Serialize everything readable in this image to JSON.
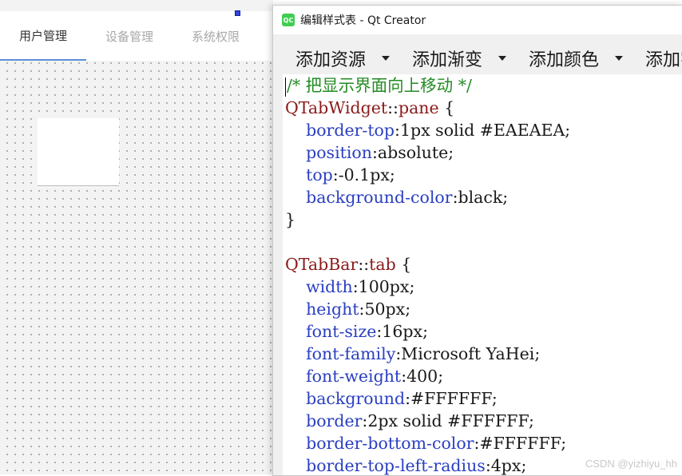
{
  "designer": {
    "tabs": [
      {
        "label": "用户管理",
        "active": true
      },
      {
        "label": "设备管理",
        "active": false
      },
      {
        "label": "系统权限",
        "active": false
      }
    ]
  },
  "dialog": {
    "title": "编辑样式表 - Qt Creator",
    "icon": "qt-logo-icon",
    "logo_text": "QC",
    "toolbar": [
      "添加资源",
      "添加渐变",
      "添加颜色",
      "添加字"
    ],
    "code": [
      [
        {
          "t": "/* 把显示界面向上移动 */",
          "c": "c-comment"
        }
      ],
      [
        {
          "t": "QTabWidget",
          "c": "c-sel"
        },
        {
          "t": "::",
          "c": "c-val"
        },
        {
          "t": "pane",
          "c": "c-sel"
        },
        {
          "t": " {",
          "c": "c-val"
        }
      ],
      [
        {
          "t": "    ",
          "c": "c-val"
        },
        {
          "t": "border-top",
          "c": "c-prop"
        },
        {
          "t": ":1px solid #EAEAEA;",
          "c": "c-val"
        }
      ],
      [
        {
          "t": "    ",
          "c": "c-val"
        },
        {
          "t": "position",
          "c": "c-prop"
        },
        {
          "t": ":absolute;",
          "c": "c-val"
        }
      ],
      [
        {
          "t": "    ",
          "c": "c-val"
        },
        {
          "t": "top",
          "c": "c-prop"
        },
        {
          "t": ":-0.1px;",
          "c": "c-val"
        }
      ],
      [
        {
          "t": "    ",
          "c": "c-val"
        },
        {
          "t": "background-color",
          "c": "c-prop"
        },
        {
          "t": ":black;",
          "c": "c-val"
        }
      ],
      [
        {
          "t": "}",
          "c": "c-val"
        }
      ],
      [],
      [
        {
          "t": "QTabBar",
          "c": "c-sel"
        },
        {
          "t": "::",
          "c": "c-val"
        },
        {
          "t": "tab",
          "c": "c-sel"
        },
        {
          "t": " {",
          "c": "c-val"
        }
      ],
      [
        {
          "t": "    ",
          "c": "c-val"
        },
        {
          "t": "width",
          "c": "c-prop"
        },
        {
          "t": ":100px;",
          "c": "c-val"
        }
      ],
      [
        {
          "t": "    ",
          "c": "c-val"
        },
        {
          "t": "height",
          "c": "c-prop"
        },
        {
          "t": ":50px;",
          "c": "c-val"
        }
      ],
      [
        {
          "t": "    ",
          "c": "c-val"
        },
        {
          "t": "font-size",
          "c": "c-prop"
        },
        {
          "t": ":16px;",
          "c": "c-val"
        }
      ],
      [
        {
          "t": "    ",
          "c": "c-val"
        },
        {
          "t": "font-family",
          "c": "c-prop"
        },
        {
          "t": ":Microsoft YaHei;",
          "c": "c-val"
        }
      ],
      [
        {
          "t": "    ",
          "c": "c-val"
        },
        {
          "t": "font-weight",
          "c": "c-prop"
        },
        {
          "t": ":400;",
          "c": "c-val"
        }
      ],
      [
        {
          "t": "    ",
          "c": "c-val"
        },
        {
          "t": "background",
          "c": "c-prop"
        },
        {
          "t": ":#FFFFFF;",
          "c": "c-val"
        }
      ],
      [
        {
          "t": "    ",
          "c": "c-val"
        },
        {
          "t": "border",
          "c": "c-prop"
        },
        {
          "t": ":2px solid #FFFFFF;",
          "c": "c-val"
        }
      ],
      [
        {
          "t": "    ",
          "c": "c-val"
        },
        {
          "t": "border-bottom-color",
          "c": "c-prop"
        },
        {
          "t": ":#FFFFFF;",
          "c": "c-val"
        }
      ],
      [
        {
          "t": "    ",
          "c": "c-val"
        },
        {
          "t": "border-top-left-radius",
          "c": "c-prop"
        },
        {
          "t": ":4px;",
          "c": "c-val"
        }
      ]
    ]
  },
  "watermark": "CSDN @yizhiyu_hh",
  "colors": {
    "comment": "#228b22",
    "selector": "#8b1a1a",
    "property": "#2a3fc1",
    "active_tab_underline": "#5b8fd6"
  }
}
